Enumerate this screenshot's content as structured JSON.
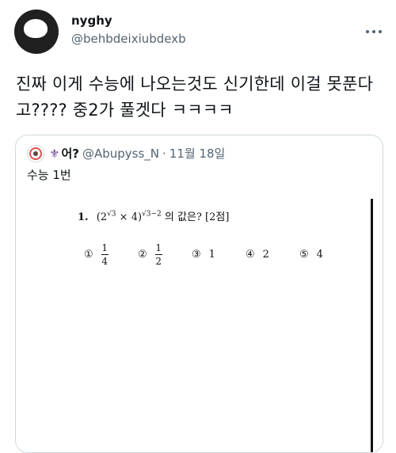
{
  "tweet": {
    "display_name": "nyghy",
    "handle": "@behbdeixiubdexb",
    "text": "진짜 이게 수능에 나오는것도 신기한데 이걸 못푼다고???? 중2가 풀겟다 ㅋㅋㅋㅋ",
    "more_icon": "more-dots-icon"
  },
  "quote": {
    "name": "어?",
    "handle": "@Abupyss_N",
    "separator": "·",
    "date": "11월 18일",
    "text": "수능 1번",
    "problem": {
      "number": "1.",
      "expression_base": "(2",
      "exp1": "√3",
      "times": " × 4)",
      "exp2": "√3−2",
      "question": "의 값은? [2점]"
    },
    "choices": [
      {
        "mark": "①",
        "num": "1",
        "den": "4"
      },
      {
        "mark": "②",
        "num": "1",
        "den": "2"
      },
      {
        "mark": "③",
        "value": "1"
      },
      {
        "mark": "④",
        "value": "2"
      },
      {
        "mark": "⑤",
        "value": "4"
      }
    ]
  }
}
